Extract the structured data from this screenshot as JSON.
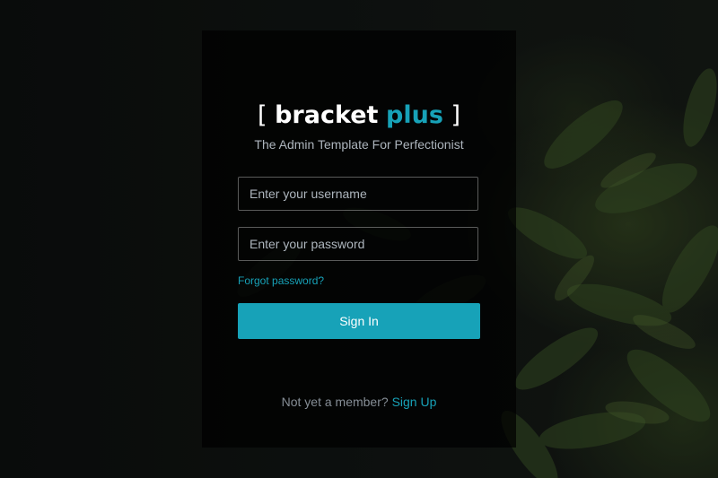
{
  "brand": {
    "open_bracket": "[",
    "name_part1": "bracket",
    "name_part2": "plus",
    "close_bracket": "]",
    "tagline": "The Admin Template For Perfectionist"
  },
  "login": {
    "username_placeholder": "Enter your username",
    "password_placeholder": "Enter your password",
    "forgot_password": "Forgot password?",
    "sign_in": "Sign In"
  },
  "signup": {
    "prompt": "Not yet a member?",
    "link": "Sign Up"
  },
  "colors": {
    "accent": "#17a2b8",
    "panel_bg": "rgba(0,0,0,0.72)"
  }
}
